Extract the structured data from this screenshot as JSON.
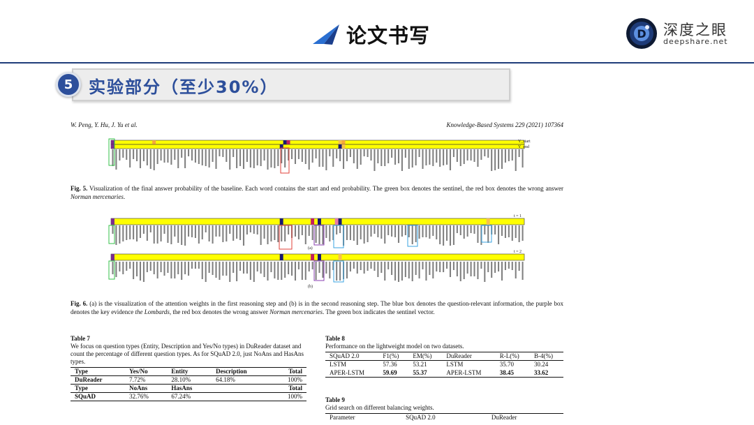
{
  "header": {
    "title": "论文书写",
    "brand_cn": "深度之眼",
    "brand_en": "deepshare.net"
  },
  "section": {
    "number": "5",
    "title": "实验部分（至少30%）"
  },
  "paper": {
    "running_authors": "W. Peng, Y. Hu, J. Yu et al.",
    "running_journal": "Knowledge-Based Systems 229 (2021) 107364",
    "fig5": {
      "label": "Fig. 5.",
      "caption_plain": " Visualization of the final answer probability of the baseline. Each word contains the start and end probability. The green box denotes the sentinel, the red box denotes the wrong answer ",
      "caption_italic": "Norman mercenaries",
      "caption_end": ".",
      "row_labels": [
        "Y_start",
        "Y_end"
      ]
    },
    "fig6": {
      "label": "Fig. 6.",
      "caption_p1": " (a) is the visualization of the attention weights in the first reasoning step and (b) is in the second reasoning step. The blue box denotes the question-relevant information, the purple box denotes the key evidence ",
      "caption_italic1": "the Lombards",
      "caption_p2": ", the red box denotes the wrong answer ",
      "caption_italic2": "Norman mercenaries",
      "caption_p3": ". The green box indicates the sentinel vector.",
      "panel_a": "(a)",
      "panel_b": "(b)",
      "step_a": "t = 1",
      "step_b": "t = 2"
    },
    "table7": {
      "label": "Table 7",
      "desc": "We focus on question types (Entity, Description and Yes/No types) in DuReader dataset and count the percentage of different question types. As for SQuAD 2.0, just NoAns and HasAns types.",
      "h1": [
        "Type",
        "Yes/No",
        "Entity",
        "Description",
        "Total"
      ],
      "r1": [
        "DuReader",
        "7.72%",
        "28.10%",
        "64.18%",
        "100%"
      ],
      "h2": [
        "Type",
        "NoAns",
        "HasAns",
        "",
        "Total"
      ],
      "r2": [
        "SQuAD",
        "32.76%",
        "67.24%",
        "",
        "100%"
      ]
    },
    "table8": {
      "label": "Table 8",
      "desc": "Performance on the lightweight model on two datasets.",
      "header": [
        "SQuAD 2.0",
        "F1(%)",
        "EM(%)",
        "DuReader",
        "R-L(%)",
        "B-4(%)"
      ],
      "row1": [
        "LSTM",
        "57.36",
        "53.21",
        "LSTM",
        "35.70",
        "30.24"
      ],
      "row2": [
        "APER-LSTM",
        "59.69",
        "55.37",
        "APER-LSTM",
        "38.45",
        "33.62"
      ]
    },
    "table9": {
      "label": "Table 9",
      "desc": "Grid search on different balancing weights.",
      "header": [
        "Parameter",
        "SQuAD 2.0",
        "DuReader"
      ]
    }
  },
  "colors": {
    "accent_blue": "#2d4f9b",
    "heat_yellow": "#ffff00",
    "sentinel_green": "#36c24a",
    "wrong_red": "#e0403a",
    "evidence_purple": "#8a3fb0",
    "relevant_blue": "#3aa3e0"
  }
}
